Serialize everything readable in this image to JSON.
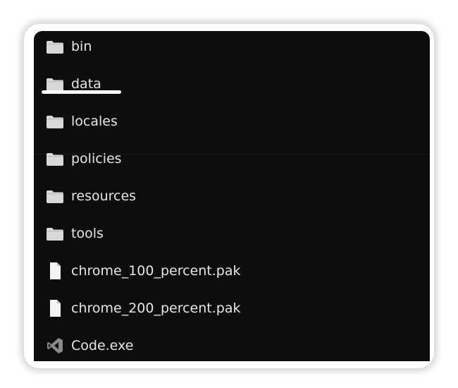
{
  "explorer": {
    "items": [
      {
        "label": "bin",
        "type": "folder",
        "icon": "folder-icon"
      },
      {
        "label": "data",
        "type": "folder",
        "icon": "folder-icon",
        "highlighted": true
      },
      {
        "label": "locales",
        "type": "folder",
        "icon": "folder-icon"
      },
      {
        "label": "policies",
        "type": "folder",
        "icon": "folder-icon"
      },
      {
        "label": "resources",
        "type": "folder",
        "icon": "folder-icon"
      },
      {
        "label": "tools",
        "type": "folder",
        "icon": "folder-icon"
      },
      {
        "label": "chrome_100_percent.pak",
        "type": "file",
        "icon": "file-icon"
      },
      {
        "label": "chrome_200_percent.pak",
        "type": "file",
        "icon": "file-icon"
      },
      {
        "label": "Code.exe",
        "type": "exe",
        "icon": "vscode-icon"
      }
    ]
  },
  "colors": {
    "background": "#0d0d0d",
    "text": "#e6e6e6",
    "folder_icon": "#d8d8d8",
    "underline": "#ffffff"
  }
}
